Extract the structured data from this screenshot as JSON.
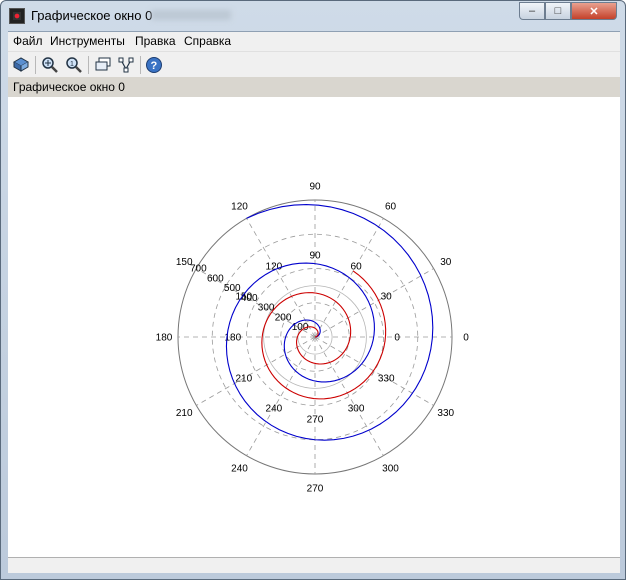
{
  "window": {
    "title": "Графическое окно 0",
    "controls": {
      "minimize": "minimize-icon",
      "maximize": "maximize-icon",
      "close": "close-icon"
    }
  },
  "menu": {
    "items": [
      {
        "label": "Файл"
      },
      {
        "label": "Инструменты"
      },
      {
        "label": "Правка"
      },
      {
        "label": "Справка"
      }
    ]
  },
  "toolbar": {
    "buttons": [
      {
        "icon": "rotate-icon"
      },
      {
        "icon": "zoom-in-icon"
      },
      {
        "icon": "zoom-fit-icon"
      },
      {
        "icon": "datatip-icon"
      },
      {
        "icon": "edit-curve-icon"
      },
      {
        "icon": "help-icon"
      }
    ]
  },
  "infobar": {
    "text": "Графическое окно 0"
  },
  "chart_data": {
    "type": "line",
    "projection": "polar",
    "angle_ticks_outer": [
      "0",
      "30",
      "60",
      "90",
      "120",
      "150",
      "180",
      "210",
      "240",
      "270",
      "300",
      "330"
    ],
    "angle_ticks_inner": [
      "0",
      "30",
      "60",
      "90",
      "120",
      "150",
      "180",
      "210",
      "240",
      "270",
      "300",
      "330"
    ],
    "radius_labels": [
      "100",
      "200",
      "300",
      "400",
      "500",
      "600",
      "700"
    ],
    "rlim": [
      0,
      700
    ],
    "grid": true,
    "series": [
      {
        "color": "#0000cc",
        "theta_deg": [
          0,
          60,
          120,
          180,
          240,
          300,
          360,
          420,
          480,
          540,
          600,
          660,
          720,
          780,
          840
        ],
        "r": [
          0,
          50,
          100,
          150,
          200,
          250,
          300,
          350,
          400,
          450,
          500,
          550,
          600,
          650,
          700
        ]
      },
      {
        "color": "#cc0000",
        "theta_deg": [
          0,
          60,
          120,
          180,
          240,
          300,
          360,
          420,
          480,
          540,
          600,
          660,
          720,
          780
        ],
        "r": [
          0,
          30,
          60,
          90,
          120,
          150,
          180,
          210,
          240,
          270,
          300,
          330,
          360,
          390
        ]
      }
    ]
  },
  "colors": {
    "series_blue": "#0000cc",
    "series_red": "#cc0000",
    "grid": "#9a9a9a"
  }
}
